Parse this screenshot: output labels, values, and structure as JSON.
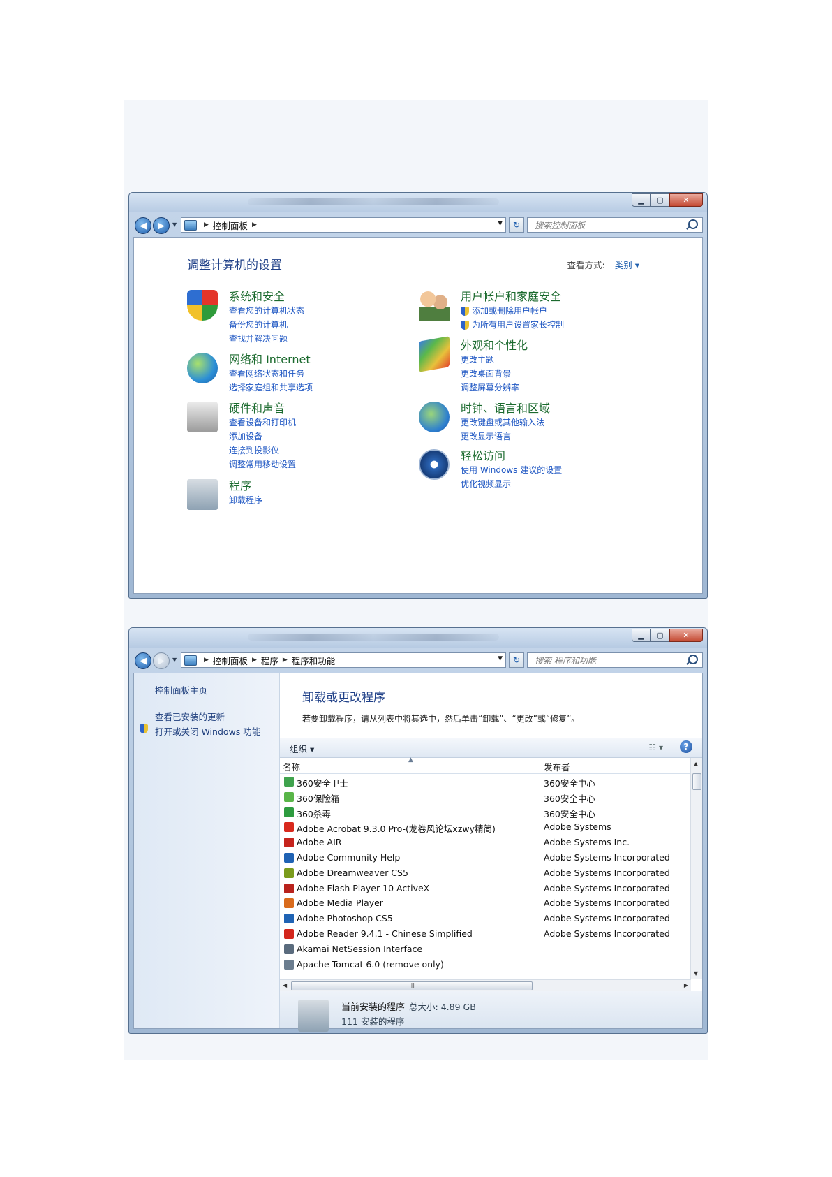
{
  "control_panel": {
    "breadcrumb": [
      "控制面板"
    ],
    "search_placeholder": "搜索控制面板",
    "heading": "调整计算机的设置",
    "view_label": "查看方式:",
    "view_value": "类别",
    "categories_left": [
      {
        "title": "系统和安全",
        "icon": "shield-security-icon",
        "links": [
          "查看您的计算机状态",
          "备份您的计算机",
          "查找并解决问题"
        ]
      },
      {
        "title": "网络和 Internet",
        "icon": "network-globe-icon",
        "links": [
          "查看网络状态和任务",
          "选择家庭组和共享选项"
        ]
      },
      {
        "title": "硬件和声音",
        "icon": "printer-icon",
        "links": [
          "查看设备和打印机",
          "添加设备",
          "连接到投影仪",
          "调整常用移动设置"
        ]
      },
      {
        "title": "程序",
        "icon": "programs-box-icon",
        "links": [
          "卸载程序"
        ]
      }
    ],
    "categories_right": [
      {
        "title": "用户帐户和家庭安全",
        "icon": "users-icon",
        "links": [
          "添加或删除用户帐户",
          "为所有用户设置家长控制"
        ],
        "shielded": true
      },
      {
        "title": "外观和个性化",
        "icon": "appearance-icon",
        "links": [
          "更改主题",
          "更改桌面背景",
          "调整屏幕分辨率"
        ]
      },
      {
        "title": "时钟、语言和区域",
        "icon": "clock-globe-icon",
        "links": [
          "更改键盘或其他输入法",
          "更改显示语言"
        ]
      },
      {
        "title": "轻松访问",
        "icon": "accessibility-icon",
        "links": [
          "使用 Windows 建议的设置",
          "优化视频显示"
        ]
      }
    ]
  },
  "programs_window": {
    "breadcrumb": [
      "控制面板",
      "程序",
      "程序和功能"
    ],
    "search_placeholder": "搜索 程序和功能",
    "left_links": [
      "控制面板主页",
      "查看已安装的更新",
      "打开或关闭 Windows 功能"
    ],
    "heading": "卸载或更改程序",
    "description": "若要卸载程序，请从列表中将其选中，然后单击“卸载”、“更改”或“修复”。",
    "organize_label": "组织 ▾",
    "columns": [
      "名称",
      "发布者"
    ],
    "rows": [
      {
        "name": "360安全卫士",
        "publisher": "360安全中心",
        "color": "#3fa34d"
      },
      {
        "name": "360保险箱",
        "publisher": "360安全中心",
        "color": "#59b548"
      },
      {
        "name": "360杀毒",
        "publisher": "360安全中心",
        "color": "#2e9c3f"
      },
      {
        "name": "Adobe Acrobat 9.3.0 Pro-(龙卷风论坛xzwy精简)",
        "publisher": "Adobe Systems",
        "color": "#d8291d"
      },
      {
        "name": "Adobe AIR",
        "publisher": "Adobe Systems Inc.",
        "color": "#c5231c"
      },
      {
        "name": "Adobe Community Help",
        "publisher": "Adobe Systems Incorporated",
        "color": "#1f62b3"
      },
      {
        "name": "Adobe Dreamweaver CS5",
        "publisher": "Adobe Systems Incorporated",
        "color": "#7a9b1c"
      },
      {
        "name": "Adobe Flash Player 10 ActiveX",
        "publisher": "Adobe Systems Incorporated",
        "color": "#b8221c"
      },
      {
        "name": "Adobe Media Player",
        "publisher": "Adobe Systems Incorporated",
        "color": "#d96b1c"
      },
      {
        "name": "Adobe Photoshop CS5",
        "publisher": "Adobe Systems Incorporated",
        "color": "#1f63b4"
      },
      {
        "name": "Adobe Reader 9.4.1 - Chinese Simplified",
        "publisher": "Adobe Systems Incorporated",
        "color": "#d3261c"
      },
      {
        "name": "Akamai NetSession Interface",
        "publisher": "",
        "color": "#5a6b7d"
      },
      {
        "name": "Apache Tomcat 6.0 (remove only)",
        "publisher": "",
        "color": "#6b7d8f"
      }
    ],
    "status_label": "当前安装的程序",
    "status_size": "总大小: 4.89 GB",
    "status_count": "111 安装的程序"
  }
}
